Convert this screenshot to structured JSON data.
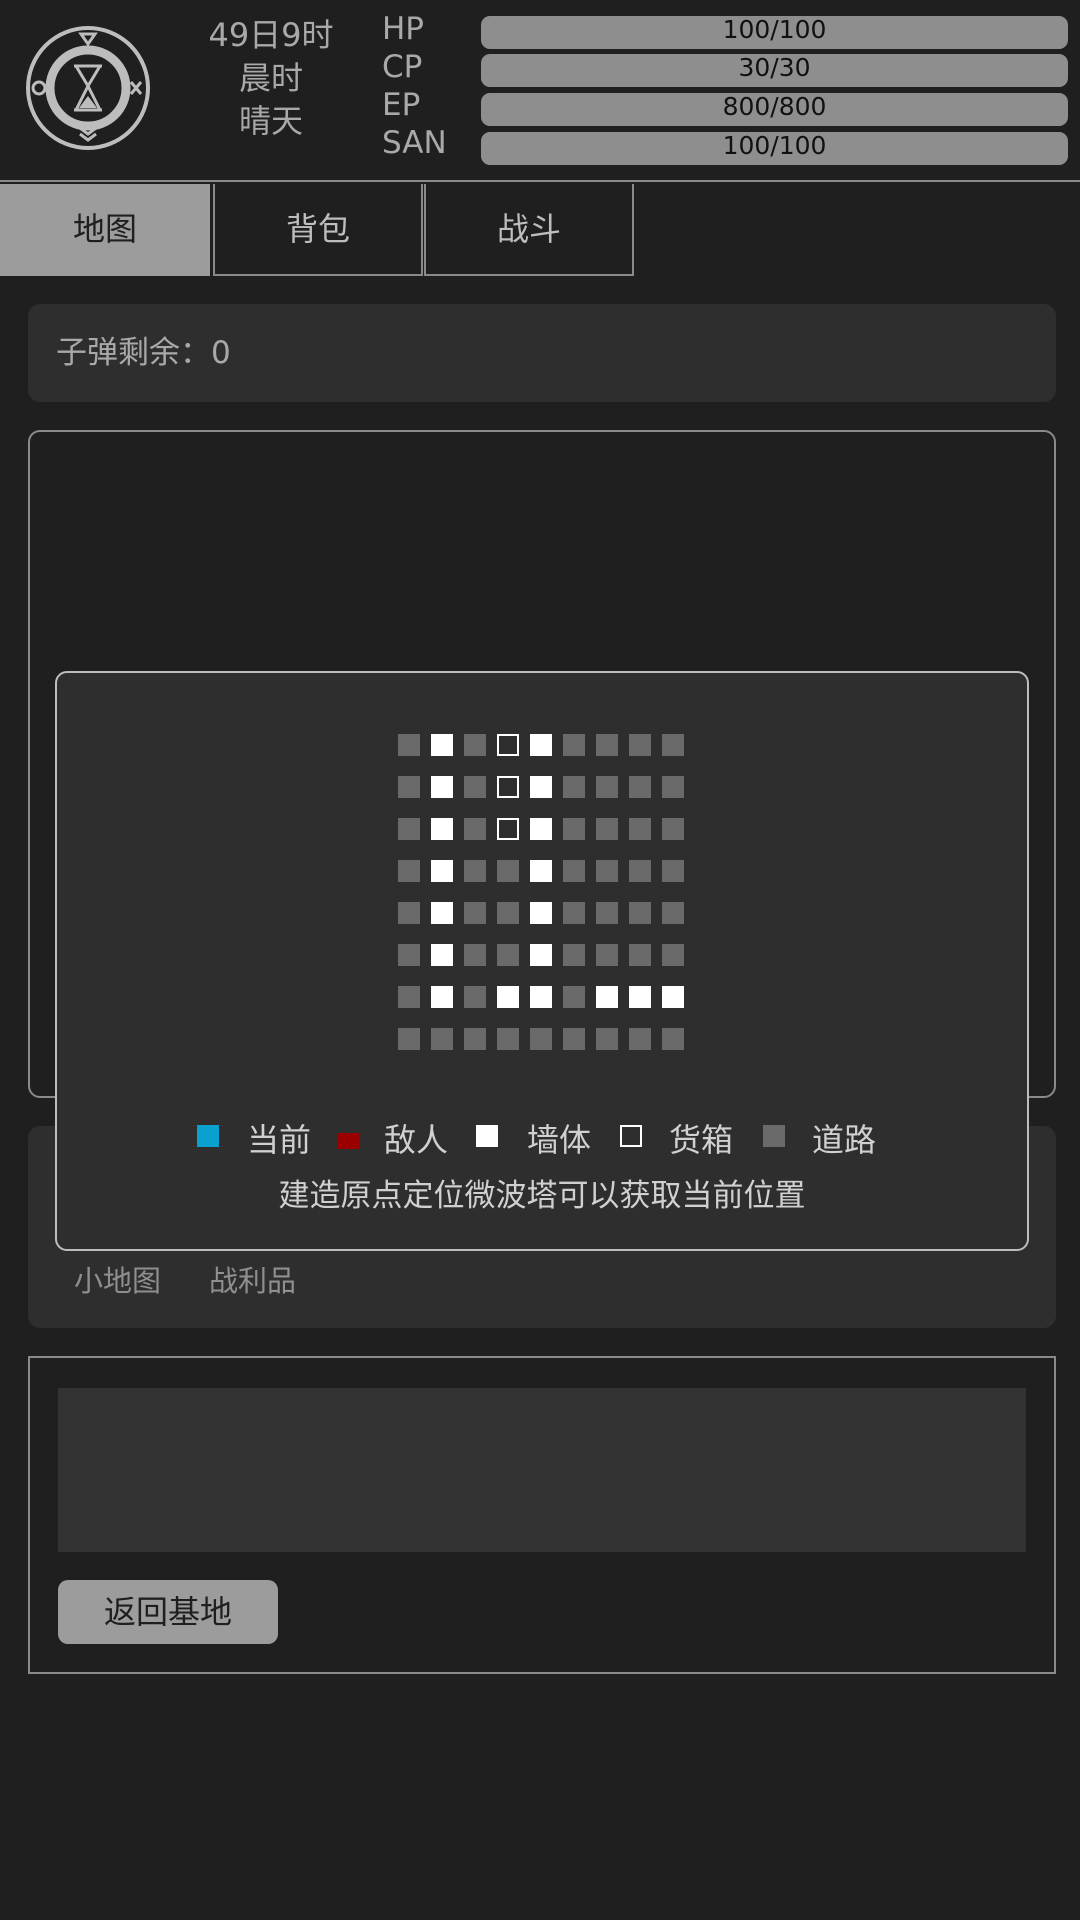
{
  "header": {
    "date": "49日9时",
    "time_of_day": "晨时",
    "weather": "晴天",
    "stats": [
      {
        "label": "HP",
        "value": "100/100"
      },
      {
        "label": "CP",
        "value": "30/30"
      },
      {
        "label": "EP",
        "value": "800/800"
      },
      {
        "label": "SAN",
        "value": "100/100"
      }
    ]
  },
  "tabs": [
    "地图",
    "背包",
    "战斗"
  ],
  "active_tab": "地图",
  "ammo_text": "子弹剩余：0",
  "sub_tabs": [
    "小地图",
    "战利品"
  ],
  "return_button": "返回基地",
  "minimap": {
    "grid": [
      [
        "road",
        "wall",
        "road",
        "crate",
        "wall",
        "road",
        "road",
        "road",
        "road"
      ],
      [
        "road",
        "wall",
        "road",
        "crate",
        "wall",
        "road",
        "road",
        "road",
        "road"
      ],
      [
        "road",
        "wall",
        "road",
        "crate",
        "wall",
        "road",
        "road",
        "road",
        "road"
      ],
      [
        "road",
        "wall",
        "road",
        "road",
        "wall",
        "road",
        "road",
        "road",
        "road"
      ],
      [
        "road",
        "wall",
        "road",
        "road",
        "wall",
        "road",
        "road",
        "road",
        "road"
      ],
      [
        "road",
        "wall",
        "road",
        "road",
        "wall",
        "road",
        "road",
        "road",
        "road"
      ],
      [
        "road",
        "wall",
        "road",
        "wall",
        "wall",
        "road",
        "wall",
        "wall",
        "wall"
      ],
      [
        "road",
        "road",
        "road",
        "road",
        "road",
        "road",
        "road",
        "road",
        "road"
      ]
    ],
    "legend": [
      {
        "type": "current",
        "label": "当前"
      },
      {
        "type": "enemy",
        "label": "敌人"
      },
      {
        "type": "wall",
        "label": "墙体"
      },
      {
        "type": "crate",
        "label": "货箱"
      },
      {
        "type": "road",
        "label": "道路"
      }
    ],
    "hint": "建造原点定位微波塔可以获取当前位置"
  },
  "colors": {
    "current": "#0aa0d0",
    "enemy": "#9a0000",
    "wall": "#ffffff",
    "road": "#6a6a6a",
    "background": "#1f1f1f"
  }
}
